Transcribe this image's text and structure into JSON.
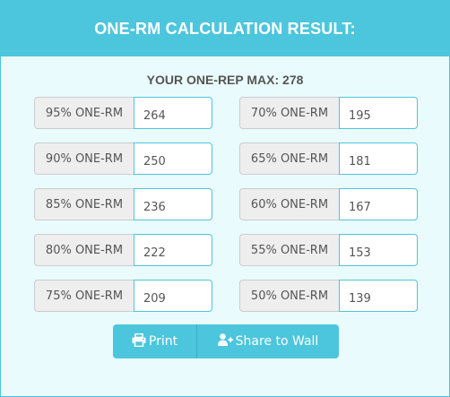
{
  "header": {
    "title": "ONE-RM CALCULATION RESULT:"
  },
  "result": {
    "one_rep_max": "YOUR ONE-REP MAX: 278"
  },
  "left_rows": [
    {
      "label": "95% ONE-RM",
      "value": "264"
    },
    {
      "label": "90% ONE-RM",
      "value": "250"
    },
    {
      "label": "85% ONE-RM",
      "value": "236"
    },
    {
      "label": "80% ONE-RM",
      "value": "222"
    },
    {
      "label": "75% ONE-RM",
      "value": "209"
    }
  ],
  "right_rows": [
    {
      "label": "70% ONE-RM",
      "value": "195"
    },
    {
      "label": "65% ONE-RM",
      "value": "181"
    },
    {
      "label": "60% ONE-RM",
      "value": "167"
    },
    {
      "label": "55% ONE-RM",
      "value": "153"
    },
    {
      "label": "50% ONE-RM",
      "value": "139"
    }
  ],
  "actions": {
    "print_label": "Print",
    "share_label": "Share to Wall"
  },
  "colors": {
    "accent": "#4cc6dc",
    "panel_bg": "#eafbfd",
    "label_bg": "#eeeeee"
  },
  "icons": {
    "print": "printer-icon",
    "share": "user-plus-icon"
  }
}
